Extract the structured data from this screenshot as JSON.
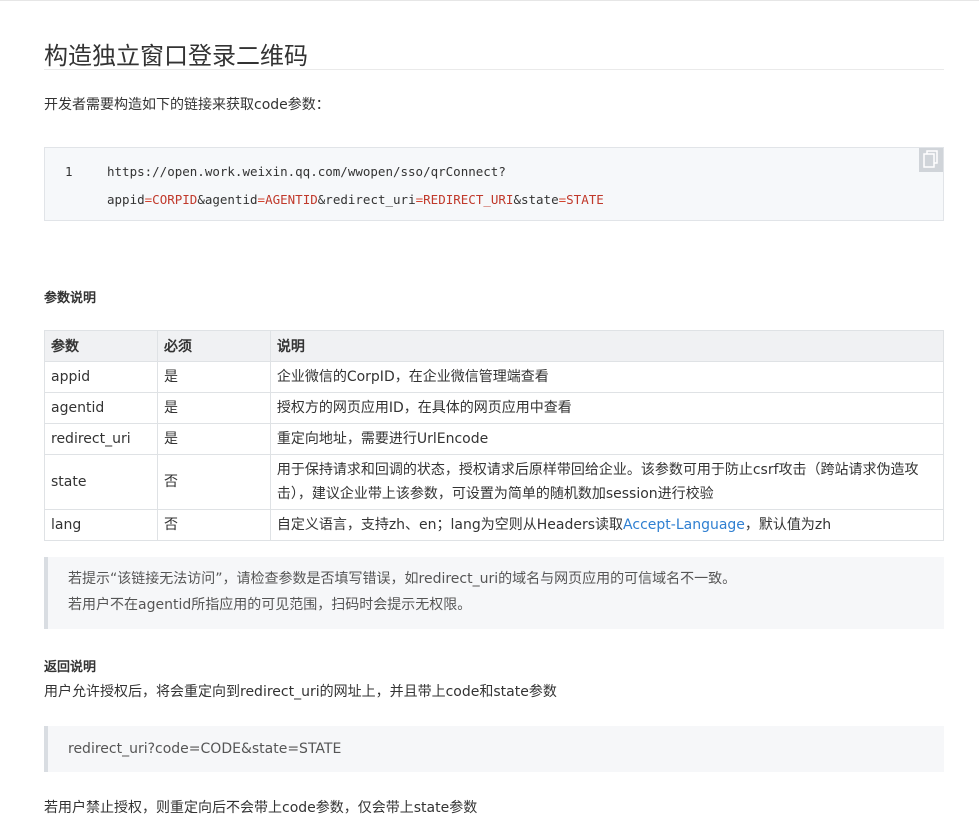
{
  "title": "构造独立窗口登录二维码",
  "intro": "开发者需要构造如下的链接来获取code参数：",
  "code": {
    "line_number": "1",
    "line1": "https://open.work.weixin.qq.com/wwopen/sso/qrConnect?",
    "tokens": [
      {
        "t": "appid",
        "k": "plain"
      },
      {
        "t": "=",
        "k": "op"
      },
      {
        "t": "CORPID",
        "k": "val"
      },
      {
        "t": "&agentid",
        "k": "plain"
      },
      {
        "t": "=",
        "k": "op"
      },
      {
        "t": "AGENTID",
        "k": "val"
      },
      {
        "t": "&redirect_uri",
        "k": "plain"
      },
      {
        "t": "=",
        "k": "op"
      },
      {
        "t": "REDIRECT_URI",
        "k": "val"
      },
      {
        "t": "&state",
        "k": "plain"
      },
      {
        "t": "=",
        "k": "op"
      },
      {
        "t": "STATE",
        "k": "val"
      }
    ],
    "copy_icon": "copy-icon"
  },
  "params_heading": "参数说明",
  "table": {
    "headers": [
      "参数",
      "必须",
      "说明"
    ],
    "rows": [
      {
        "param": "appid",
        "required": "是",
        "desc": "企业微信的CorpID，在企业微信管理端查看"
      },
      {
        "param": "agentid",
        "required": "是",
        "desc": "授权方的网页应用ID，在具体的网页应用中查看"
      },
      {
        "param": "redirect_uri",
        "required": "是",
        "desc": "重定向地址，需要进行UrlEncode"
      },
      {
        "param": "state",
        "required": "否",
        "desc": "用于保持请求和回调的状态，授权请求后原样带回给企业。该参数可用于防止csrf攻击（跨站请求伪造攻击），建议企业带上该参数，可设置为简单的随机数加session进行校验"
      },
      {
        "param": "lang",
        "required": "否",
        "desc_before": "自定义语言，支持zh、en；lang为空则从Headers读取",
        "desc_link": "Accept-Language",
        "desc_after": "，默认值为zh"
      }
    ]
  },
  "notice": {
    "line1": "若提示“该链接无法访问”，请检查参数是否填写错误，如redirect_uri的域名与网页应用的可信域名不一致。",
    "line2": "若用户不在agentid所指应用的可见范围，扫码时会提示无权限。"
  },
  "return_heading": "返回说明",
  "return_text": "用户允许授权后，将会重定向到redirect_uri的网址上，并且带上code和state参数",
  "return_code": "redirect_uri?code=CODE&state=STATE",
  "deny_text": "若用户禁止授权，则重定向后不会带上code参数，仅会带上state参数"
}
